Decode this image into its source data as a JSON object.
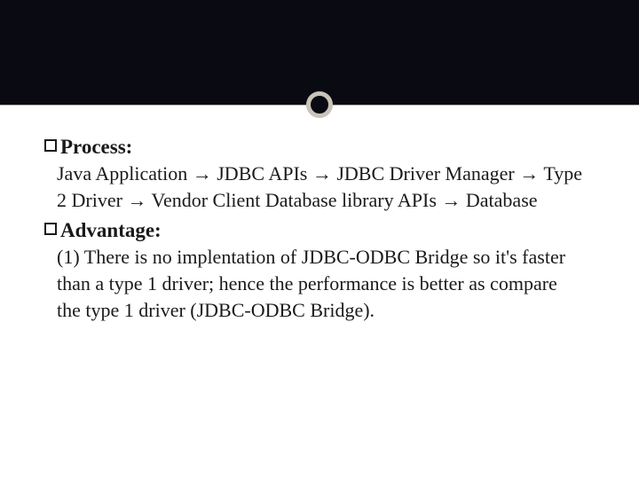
{
  "sections": [
    {
      "heading": "Process:",
      "body": "Java Application   →  JDBC APIs     →  JDBC Driver Manager →   Type 2 Driver   →  Vendor Client Database library APIs →  Database"
    },
    {
      "heading": "Advantage:",
      "body": "(1)   There is no implentation of JDBC-ODBC Bridge so it's faster than a type 1 driver; hence the performance is better as compare the type 1 driver (JDBC-ODBC Bridge)."
    }
  ]
}
